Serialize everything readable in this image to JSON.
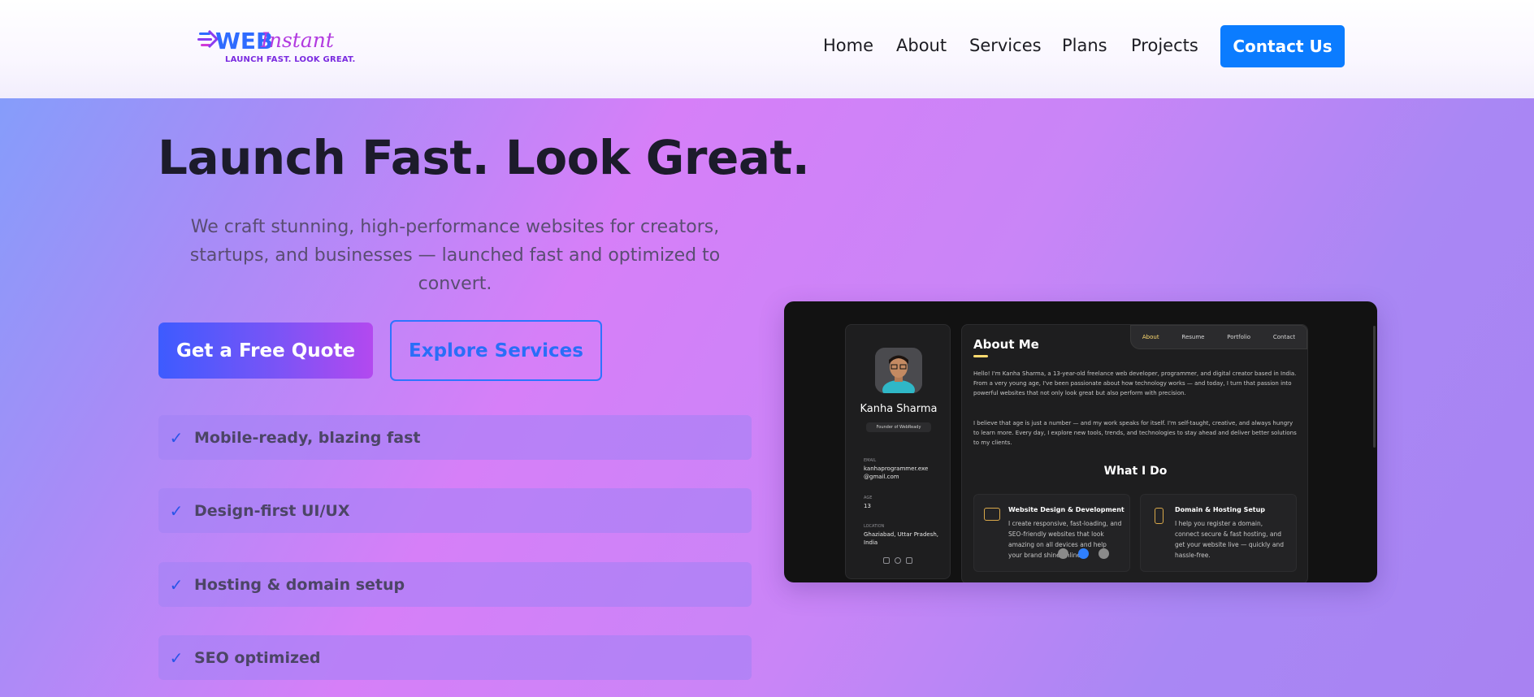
{
  "brand": {
    "name_part1": "WEB",
    "name_part2": "Instant",
    "tagline": "LAUNCH FAST. LOOK GREAT.",
    "colors": {
      "blue": "#2f6bff",
      "purple": "#8a3cf0",
      "pink": "#d23ad8"
    }
  },
  "nav": {
    "items": [
      "Home",
      "About",
      "Services",
      "Plans",
      "Projects"
    ],
    "contact_label": "Contact Us"
  },
  "hero": {
    "title": "Launch Fast. Look Great.",
    "subtitle": "We craft stunning, high-performance websites for creators, startups, and businesses — launched fast and optimized to convert.",
    "primary_cta": "Get a Free Quote",
    "secondary_cta": "Explore Services",
    "features": [
      "Mobile-ready, blazing fast",
      "Design-first UI/UX",
      "Hosting & domain setup",
      "SEO optimized"
    ],
    "check_icon": "✓"
  },
  "preview": {
    "profile": {
      "name": "Kanha Sharma",
      "role": "Founder of WebReady",
      "email_label": "EMAIL",
      "email": "kanhaprogrammer.exe @gmail.com",
      "age_label": "AGE",
      "age": "13",
      "location_label": "LOCATION",
      "location": "Ghaziabad, Uttar Pradesh, India",
      "socials": [
        "linkedin-icon",
        "whatsapp-icon",
        "instagram-icon"
      ]
    },
    "tabs": [
      "About",
      "Resume",
      "Portfolio",
      "Contact"
    ],
    "active_tab": "About",
    "about_heading": "About Me",
    "about_p1": "Hello! I'm Kanha Sharma, a 13-year-old freelance web developer, programmer, and digital creator based in India. From a very young age, I've been passionate about how technology works — and today, I turn that passion into powerful websites that not only look great but also perform with precision.",
    "about_p2": "I believe that age is just a number — and my work speaks for itself. I'm self-taught, creative, and always hungry to learn more. Every day, I explore new tools, trends, and technologies to stay ahead and deliver better solutions to my clients.",
    "what_i_do": "What I Do",
    "services": [
      {
        "title": "Website Design & Development",
        "text": "I create responsive, fast-loading, and SEO-friendly websites that look amazing on all devices and help your brand shine online."
      },
      {
        "title": "Domain & Hosting Setup",
        "text": "I help you register a domain, connect secure & fast hosting, and get your website live — quickly and hassle-free."
      }
    ],
    "carousel_active_index": 1,
    "carousel_count": 3
  }
}
